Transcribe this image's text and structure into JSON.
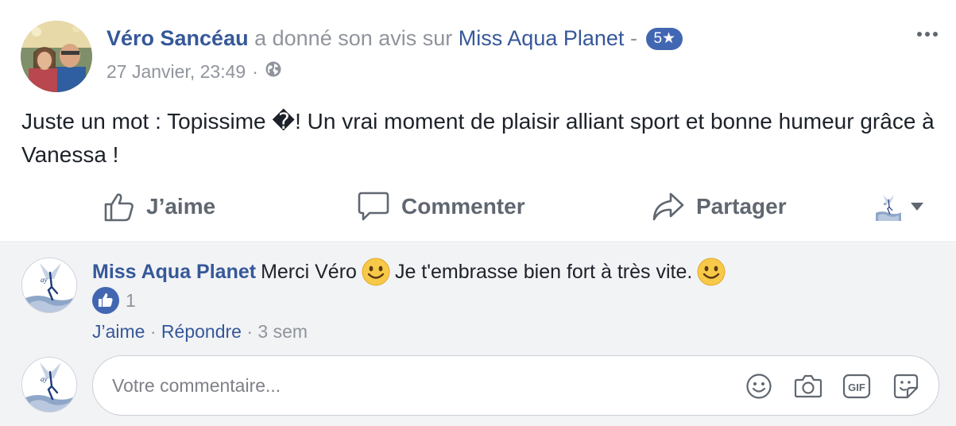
{
  "post": {
    "author": "Véro Sancéau",
    "verb": "a donné son avis sur",
    "page": "Miss Aqua Planet",
    "dash": "-",
    "rating": "5★",
    "timestamp": "27 Janvier, 23:49",
    "meta_sep": "·",
    "privacy_icon": "globe-icon",
    "text": "Juste un mot : Topissime �! Un vrai moment de plaisir alliant sport et bonne humeur grâce à Vanessa !"
  },
  "actions": {
    "like": "J’aime",
    "comment": "Commenter",
    "share": "Partager"
  },
  "comment": {
    "author": "Miss Aqua Planet",
    "text_1": "Merci Véro",
    "text_2": "Je t'embrasse bien fort à très vite.",
    "like_count": "1",
    "like_label": "J’aime",
    "sep": "·",
    "reply_label": "Répondre",
    "time": "3 sem"
  },
  "composer": {
    "placeholder": "Votre commentaire..."
  },
  "colors": {
    "link": "#365899",
    "muted": "#90949c",
    "action": "#606770",
    "accent": "#4267b2",
    "comments_bg": "#f2f3f5"
  }
}
